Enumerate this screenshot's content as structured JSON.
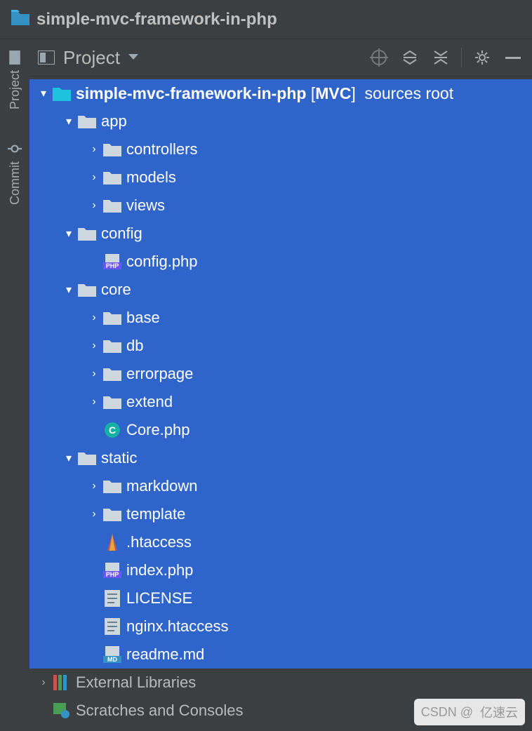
{
  "title": "simple-mvc-framework-in-php",
  "rail": {
    "project": "Project",
    "commit": "Commit"
  },
  "toolbar": {
    "project_label": "Project"
  },
  "tree": {
    "root": {
      "label": "simple-mvc-framework-in-php",
      "tag": "MVC",
      "suffix": "sources root"
    },
    "nodes": [
      {
        "depth": 1,
        "expand": "down",
        "icon": "folder",
        "label": "app",
        "sel": true
      },
      {
        "depth": 2,
        "expand": "right",
        "icon": "folder",
        "label": "controllers",
        "sel": true
      },
      {
        "depth": 2,
        "expand": "right",
        "icon": "folder",
        "label": "models",
        "sel": true
      },
      {
        "depth": 2,
        "expand": "right",
        "icon": "folder",
        "label": "views",
        "sel": true
      },
      {
        "depth": 1,
        "expand": "down",
        "icon": "folder",
        "label": "config",
        "sel": true
      },
      {
        "depth": 2,
        "expand": "none",
        "icon": "php",
        "label": "config.php",
        "sel": true
      },
      {
        "depth": 1,
        "expand": "down",
        "icon": "folder",
        "label": "core",
        "sel": true
      },
      {
        "depth": 2,
        "expand": "right",
        "icon": "folder",
        "label": "base",
        "sel": true
      },
      {
        "depth": 2,
        "expand": "right",
        "icon": "folder",
        "label": "db",
        "sel": true
      },
      {
        "depth": 2,
        "expand": "right",
        "icon": "folder",
        "label": "errorpage",
        "sel": true
      },
      {
        "depth": 2,
        "expand": "right",
        "icon": "folder",
        "label": "extend",
        "sel": true
      },
      {
        "depth": 2,
        "expand": "none",
        "icon": "class",
        "label": "Core.php",
        "sel": true
      },
      {
        "depth": 1,
        "expand": "down",
        "icon": "folder",
        "label": "static",
        "sel": true
      },
      {
        "depth": 2,
        "expand": "right",
        "icon": "folder",
        "label": "markdown",
        "sel": true
      },
      {
        "depth": 2,
        "expand": "right",
        "icon": "folder",
        "label": "template",
        "sel": true
      },
      {
        "depth": 2,
        "expand": "none",
        "icon": "apache",
        "label": ".htaccess",
        "sel": true
      },
      {
        "depth": 2,
        "expand": "none",
        "icon": "php",
        "label": "index.php",
        "sel": true
      },
      {
        "depth": 2,
        "expand": "none",
        "icon": "text",
        "label": "LICENSE",
        "sel": true
      },
      {
        "depth": 2,
        "expand": "none",
        "icon": "text",
        "label": "nginx.htaccess",
        "sel": true
      },
      {
        "depth": 2,
        "expand": "none",
        "icon": "md",
        "label": "readme.md",
        "sel": true
      }
    ],
    "external": "External Libraries",
    "scratches": "Scratches and Consoles"
  },
  "watermark": {
    "csdn": "CSDN @",
    "ysy": "亿速云"
  }
}
